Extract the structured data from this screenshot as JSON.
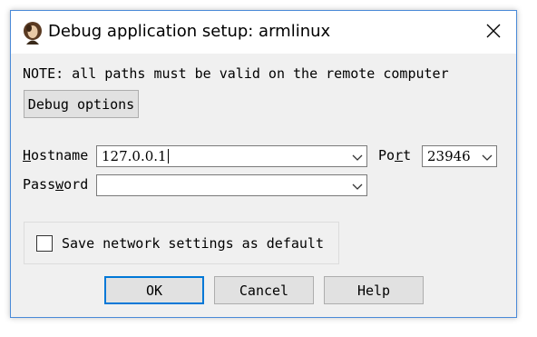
{
  "window": {
    "title": "Debug application setup: armlinux",
    "app_icon": "portrait-icon",
    "close_icon": "close-icon"
  },
  "note": "NOTE: all paths must be valid on the remote computer",
  "debug_options_label": "Debug options",
  "hostname": {
    "label_accel": "H",
    "label_rest": "ostname",
    "value": "127.0.0.1"
  },
  "port": {
    "label_pre": "Po",
    "label_accel": "r",
    "label_post": "t",
    "value": "23946"
  },
  "password": {
    "label_pre": "Pass",
    "label_accel": "w",
    "label_post": "ord",
    "value": ""
  },
  "save_checkbox": {
    "label": "Save network settings as default",
    "checked": false
  },
  "buttons": {
    "ok": "OK",
    "cancel": "Cancel",
    "help": "Help"
  },
  "colors": {
    "accent": "#0078d7",
    "window_border": "#4a8ad8",
    "dialog_bg": "#f0f0f0"
  }
}
